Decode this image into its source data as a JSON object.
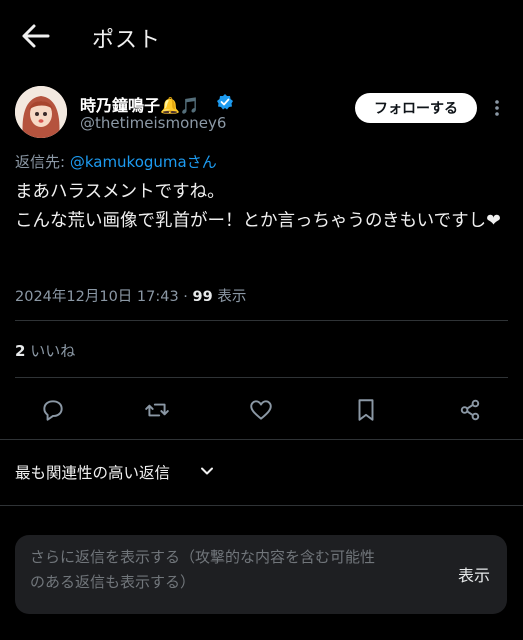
{
  "header": {
    "title": "ポスト",
    "back_icon": "back-arrow-icon"
  },
  "tweet": {
    "display_name": "時乃鐘鳴子🔔🎵",
    "handle": "@thetimeismoney6",
    "follow_label": "フォローする",
    "reply_prefix": "返信先: ",
    "reply_mention": "@kamukogumaさん",
    "text": "まあハラスメントですね。\nこんな荒い画像で乳首がー！とか言っちゃうのきもいですし❤",
    "timestamp": "2024年12月10日 17:43",
    "separator": " · ",
    "views": "99",
    "views_label": " 表示",
    "likes_count": "2",
    "likes_label": " いいね"
  },
  "actions": [
    "reply-icon",
    "retweet-icon",
    "like-icon",
    "bookmark-icon",
    "share-icon"
  ],
  "replies": {
    "sort_label": "最も関連性の高い返信",
    "placeholder": "さらに返信を表示する（攻撃的な内容を含む可能性\nのある返信も表示する）",
    "show_label": "表示"
  },
  "colors": {
    "accent": "#1d9bf0",
    "background": "#000000",
    "muted": "#8b98a5"
  }
}
